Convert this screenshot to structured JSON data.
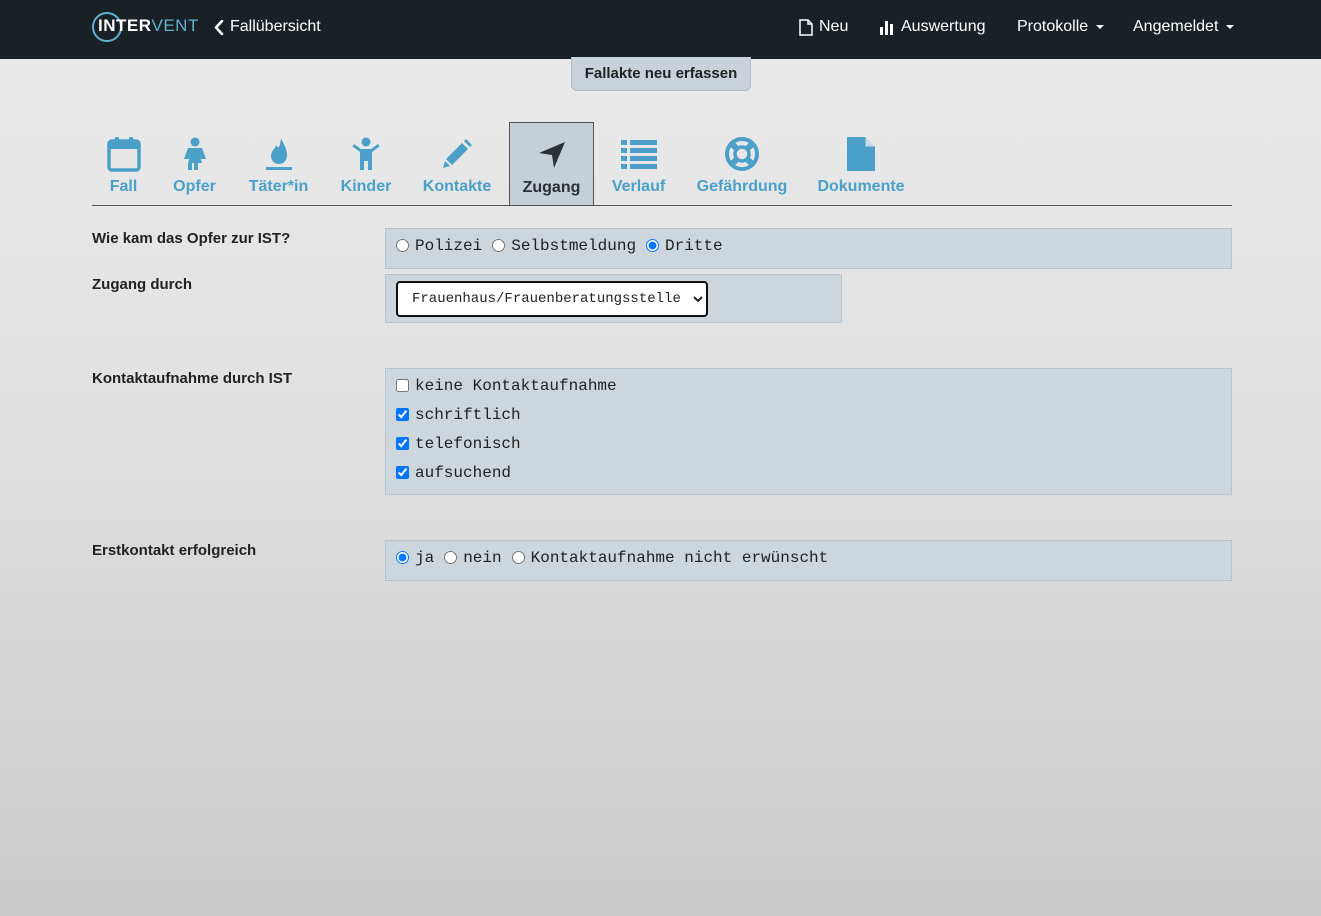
{
  "navbar": {
    "logo_text_a": "INTER",
    "logo_text_b": "VENT",
    "back_label": "Fallübersicht",
    "new_label": "Neu",
    "eval_label": "Auswertung",
    "protocols_label": "Protokolle",
    "account_label": "Angemeldet"
  },
  "page_title": "Fallakte neu erfassen",
  "tabs": [
    {
      "label": "Fall",
      "icon": "calendar-icon"
    },
    {
      "label": "Opfer",
      "icon": "female-icon"
    },
    {
      "label": "Täter*in",
      "icon": "fire-icon"
    },
    {
      "label": "Kinder",
      "icon": "child-icon"
    },
    {
      "label": "Kontakte",
      "icon": "pencil-icon"
    },
    {
      "label": "Zugang",
      "icon": "location-arrow-icon",
      "active": true
    },
    {
      "label": "Verlauf",
      "icon": "list-icon"
    },
    {
      "label": "Gefährdung",
      "icon": "life-ring-icon"
    },
    {
      "label": "Dokumente",
      "icon": "file-icon"
    }
  ],
  "form": {
    "access": {
      "label": "Wie kam das Opfer zur IST?",
      "options": [
        "Polizei",
        "Selbstmeldung",
        "Dritte"
      ],
      "selected": "Dritte"
    },
    "access_by": {
      "label": "Zugang durch",
      "value": "Frauenhaus/Frauenberatungsstelle"
    },
    "contact": {
      "label": "Kontaktaufnahme durch IST",
      "options": [
        {
          "label": "keine Kontaktaufnahme",
          "checked": false
        },
        {
          "label": "schriftlich",
          "checked": true
        },
        {
          "label": "telefonisch",
          "checked": true
        },
        {
          "label": "aufsuchend",
          "checked": true
        }
      ]
    },
    "first_contact": {
      "label": "Erstkontakt erfolgreich",
      "options": [
        "ja",
        "nein",
        "Kontaktaufnahme nicht erwünscht"
      ],
      "selected": "ja"
    }
  },
  "colors": {
    "navbar_bg": "#1a2126",
    "tab_accent": "#4aa0c9",
    "active_tab_bg": "#c6cfd7",
    "field_box_bg": "#ced6dd"
  }
}
